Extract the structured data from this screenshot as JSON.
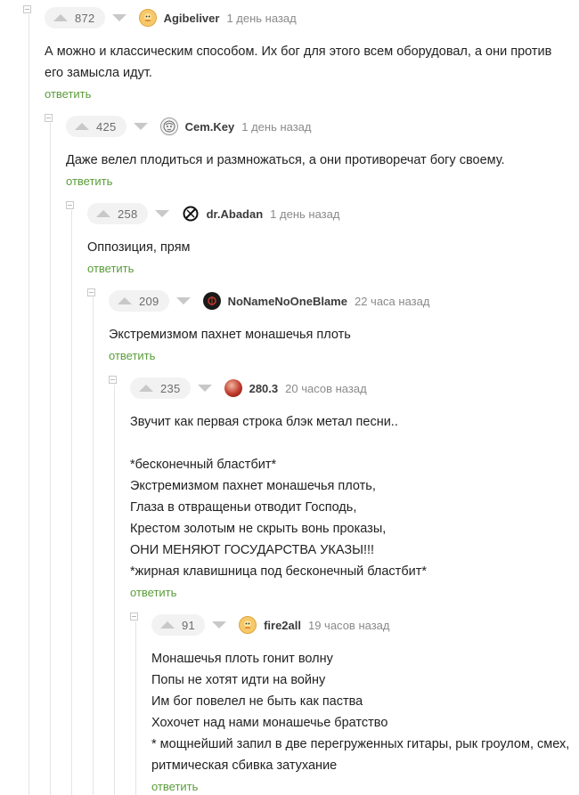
{
  "comments": [
    {
      "score": "872",
      "author": "Agibeliver",
      "time": "1 день назад",
      "avatar_icon": "duck-avatar-icon",
      "lines": [
        "А можно и классическим способом. Их бог для этого всем оборудовал, а они против его замысла идут."
      ],
      "reply_label": "ответить"
    },
    {
      "score": "425",
      "author": "Cem.Key",
      "time": "1 день назад",
      "avatar_icon": "sketch-face-avatar-icon",
      "lines": [
        "Даже велел плодиться и размножаться, а они противоречат богу своему."
      ],
      "reply_label": "ответить"
    },
    {
      "score": "258",
      "author": "dr.Abadan",
      "time": "1 день назад",
      "avatar_icon": "crossed-circle-avatar-icon",
      "lines": [
        "Оппозиция, прям"
      ],
      "reply_label": "ответить"
    },
    {
      "score": "209",
      "author": "NoNameNoOneBlame",
      "time": "22 часа назад",
      "avatar_icon": "dark-emblem-avatar-icon",
      "lines": [
        "Экстремизмом пахнет монашечья плоть"
      ],
      "reply_label": "ответить"
    },
    {
      "score": "235",
      "author": "280.3",
      "time": "20 часов назад",
      "avatar_icon": "red-photo-avatar-icon",
      "lines": [
        "Звучит как первая строка блэк метал песни..",
        "",
        "*бесконечный бластбит*",
        "Экстремизмом пахнет монашечья плоть,",
        "Глаза в отвращеньи отводит Господь,",
        "Крестом золотым не скрыть вонь проказы,",
        "ОНИ МЕНЯЮТ ГОСУДАРСТВА УКАЗЫ!!!",
        "*жирная клавишница под бесконечный бластбит*"
      ],
      "reply_label": "ответить"
    },
    {
      "score": "91",
      "author": "fire2all",
      "time": "19 часов назад",
      "avatar_icon": "duck-avatar-icon",
      "lines": [
        "Монашечья плоть гонит волну",
        "Попы не хотят идти на войну",
        "Им бог повелел не быть как паства",
        "Хохочет над нами монашечье братство",
        "* мощнейший запил в две перегруженных гитары, рык гроулом, смех, ритмическая сбивка затухание"
      ],
      "reply_label": "ответить"
    }
  ],
  "colors": {
    "reply": "#5a9c3a",
    "rating_bg": "#f2f2f2",
    "arrow": "#c8c8c8",
    "thread_line": "#e4e4e4"
  }
}
